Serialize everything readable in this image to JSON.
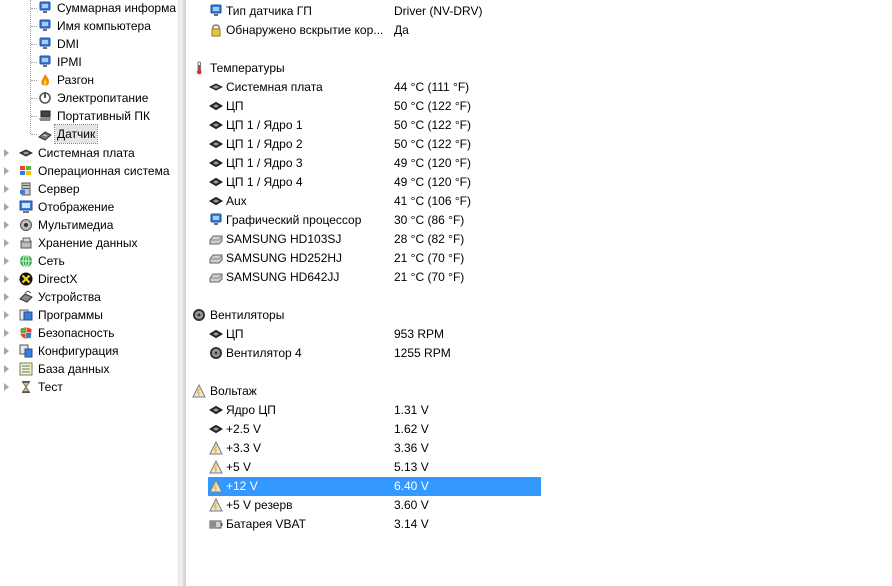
{
  "tree": {
    "children": [
      {
        "label": "Суммарная информа",
        "icon": "monitor-icon"
      },
      {
        "label": "Имя компьютера",
        "icon": "monitor-icon"
      },
      {
        "label": "DMI",
        "icon": "monitor-icon"
      },
      {
        "label": "IPMI",
        "icon": "monitor-icon"
      },
      {
        "label": "Разгон",
        "icon": "flame-icon"
      },
      {
        "label": "Электропитание",
        "icon": "power-icon"
      },
      {
        "label": "Портативный ПК",
        "icon": "laptop-icon"
      },
      {
        "label": "Датчик",
        "icon": "sensor-icon",
        "selected": true
      }
    ],
    "roots": [
      {
        "label": "Системная плата",
        "icon": "motherboard-icon"
      },
      {
        "label": "Операционная система",
        "icon": "windows-icon"
      },
      {
        "label": "Сервер",
        "icon": "server-icon"
      },
      {
        "label": "Отображение",
        "icon": "display-icon"
      },
      {
        "label": "Мультимедиа",
        "icon": "speaker-icon"
      },
      {
        "label": "Хранение данных",
        "icon": "storage-icon"
      },
      {
        "label": "Сеть",
        "icon": "network-icon"
      },
      {
        "label": "DirectX",
        "icon": "directx-icon"
      },
      {
        "label": "Устройства",
        "icon": "devices-icon"
      },
      {
        "label": "Программы",
        "icon": "programs-icon"
      },
      {
        "label": "Безопасность",
        "icon": "shield-icon"
      },
      {
        "label": "Конфигурация",
        "icon": "config-icon"
      },
      {
        "label": "База данных",
        "icon": "database-icon"
      },
      {
        "label": "Тест",
        "icon": "hourglass-icon"
      }
    ]
  },
  "details": {
    "top_items": [
      {
        "name": "Тип датчика ГП",
        "value": "Driver  (NV-DRV)",
        "icon": "monitor-icon"
      },
      {
        "name": "Обнаружено вскрытие кор...",
        "value": "Да",
        "icon": "lock-icon"
      }
    ],
    "groups": [
      {
        "title": "Температуры",
        "icon": "thermometer-icon",
        "items": [
          {
            "name": "Системная плата",
            "value": "44 °C  (111 °F)",
            "icon": "motherboard-icon"
          },
          {
            "name": "ЦП",
            "value": "50 °C  (122 °F)",
            "icon": "chip-icon"
          },
          {
            "name": "ЦП 1 / Ядро 1",
            "value": "50 °C  (122 °F)",
            "icon": "chip-icon"
          },
          {
            "name": "ЦП 1 / Ядро 2",
            "value": "50 °C  (122 °F)",
            "icon": "chip-icon"
          },
          {
            "name": "ЦП 1 / Ядро 3",
            "value": "49 °C  (120 °F)",
            "icon": "chip-icon"
          },
          {
            "name": "ЦП 1 / Ядро 4",
            "value": "49 °C  (120 °F)",
            "icon": "chip-icon"
          },
          {
            "name": "Aux",
            "value": "41 °C  (106 °F)",
            "icon": "chip-icon"
          },
          {
            "name": "Графический процессор",
            "value": "30 °C  (86 °F)",
            "icon": "monitor-icon"
          },
          {
            "name": "SAMSUNG HD103SJ",
            "value": "28 °C  (82 °F)",
            "icon": "hdd-icon"
          },
          {
            "name": "SAMSUNG HD252HJ",
            "value": "21 °C  (70 °F)",
            "icon": "hdd-icon"
          },
          {
            "name": "SAMSUNG HD642JJ",
            "value": "21 °C  (70 °F)",
            "icon": "hdd-icon"
          }
        ]
      },
      {
        "title": "Вентиляторы",
        "icon": "fan-icon",
        "items": [
          {
            "name": "ЦП",
            "value": "953 RPM",
            "icon": "chip-icon"
          },
          {
            "name": "Вентилятор 4",
            "value": "1255 RPM",
            "icon": "fan-icon"
          }
        ]
      },
      {
        "title": "Вольтаж",
        "icon": "voltage-icon",
        "items": [
          {
            "name": "Ядро ЦП",
            "value": "1.31 V",
            "icon": "chip-icon"
          },
          {
            "name": "+2.5 V",
            "value": "1.62 V",
            "icon": "chip-icon"
          },
          {
            "name": "+3.3 V",
            "value": "3.36 V",
            "icon": "voltage-icon"
          },
          {
            "name": "+5 V",
            "value": "5.13 V",
            "icon": "voltage-icon"
          },
          {
            "name": "+12 V",
            "value": "6.40 V",
            "icon": "voltage-icon",
            "selected": true
          },
          {
            "name": "+5 V резерв",
            "value": "3.60 V",
            "icon": "voltage-icon"
          },
          {
            "name": "Батарея VBAT",
            "value": "3.14 V",
            "icon": "battery-icon"
          }
        ]
      }
    ]
  },
  "colors": {
    "selection": "#3399ff",
    "tree_selection": "#e4e4e4",
    "splitter": "#dcdcdc"
  }
}
